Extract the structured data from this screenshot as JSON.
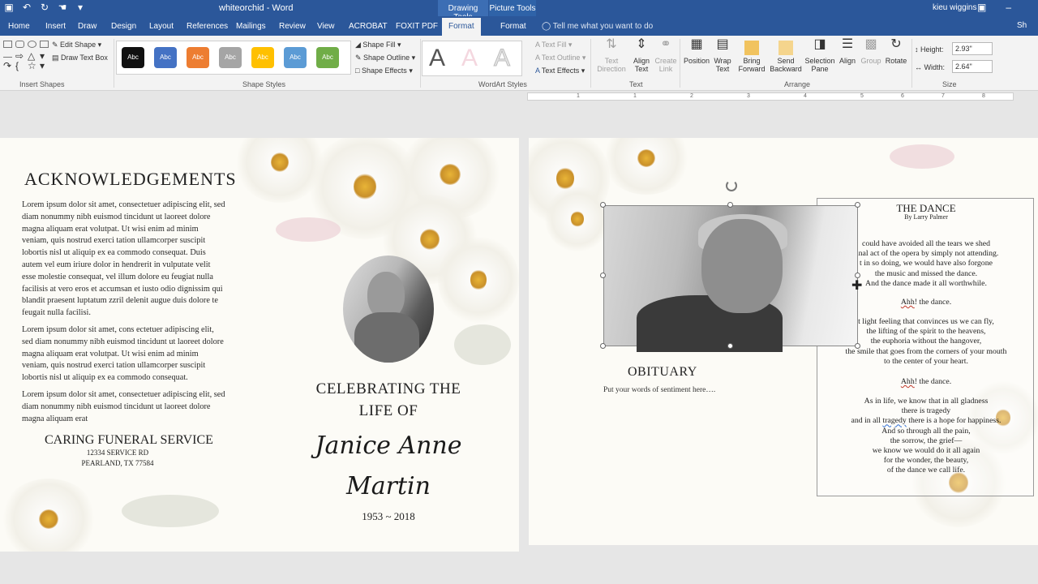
{
  "titlebar": {
    "doc_title": "whiteorchid - Word",
    "ctx_drawing": "Drawing Tools",
    "ctx_picture": "Picture Tools",
    "user": "kieu wiggins",
    "qat_icons": [
      "save-icon",
      "undo-icon",
      "redo-icon",
      "touch-icon",
      "customize-icon"
    ]
  },
  "tabs": [
    {
      "label": "Home"
    },
    {
      "label": "Insert"
    },
    {
      "label": "Draw"
    },
    {
      "label": "Design"
    },
    {
      "label": "Layout"
    },
    {
      "label": "References"
    },
    {
      "label": "Mailings"
    },
    {
      "label": "Review"
    },
    {
      "label": "View"
    },
    {
      "label": "ACROBAT"
    },
    {
      "label": "FOXIT PDF"
    },
    {
      "label": "Format"
    },
    {
      "label": "Format"
    }
  ],
  "tell_me": "Tell me what you want to do",
  "share": "Sh",
  "ribbon": {
    "insert_shapes": {
      "edit_shape": "Edit Shape",
      "draw_text_box": "Draw Text Box",
      "label": "Insert Shapes"
    },
    "shape_styles": {
      "swatches": [
        {
          "text": "Abc",
          "color": "#111111"
        },
        {
          "text": "Abc",
          "color": "#4472c4"
        },
        {
          "text": "Abc",
          "color": "#ed7d31"
        },
        {
          "text": "Abc",
          "color": "#a5a5a5"
        },
        {
          "text": "Abc",
          "color": "#ffc000"
        },
        {
          "text": "Abc",
          "color": "#5b9bd5"
        },
        {
          "text": "Abc",
          "color": "#70ad47"
        }
      ],
      "shape_fill": "Shape Fill",
      "shape_outline": "Shape Outline",
      "shape_effects": "Shape Effects",
      "label": "Shape Styles"
    },
    "wordart": {
      "letters": [
        "A",
        "A",
        "A"
      ],
      "text_fill": "Text Fill",
      "text_outline": "Text Outline",
      "text_effects": "Text Effects",
      "label": "WordArt Styles"
    },
    "text_group": {
      "text_direction": "Text Direction",
      "align_text": "Align Text",
      "create_link": "Create Link",
      "label": "Text"
    },
    "arrange": {
      "position": "Position",
      "wrap_text": "Wrap Text",
      "bring_forward": "Bring Forward",
      "send_backward": "Send Backward",
      "selection_pane": "Selection Pane",
      "align": "Align",
      "group": "Group",
      "rotate": "Rotate",
      "label": "Arrange"
    },
    "size": {
      "height_label": "Height:",
      "height_value": "2.93\"",
      "width_label": "Width:",
      "width_value": "2.64\"",
      "label": "Size"
    }
  },
  "ruler_marks": [
    "1",
    "1",
    "2",
    "3",
    "4",
    "5",
    "6",
    "7",
    "8"
  ],
  "left_page": {
    "ack_title": "ACKNOWLEDGEMENTS",
    "paragraphs": [
      "Lorem ipsum dolor sit amet, consectetuer adipiscing elit, sed diam nonummy nibh euismod tincidunt ut laoreet dolore magna aliquam erat volutpat. Ut wisi enim ad minim veniam, quis nostrud exerci tation ullamcorper suscipit lobortis nisl ut aliquip ex ea commodo consequat. Duis autem vel eum iriure dolor in hendrerit in vulputate velit esse molestie consequat, vel illum dolore eu feugiat nulla facilisis at vero eros et accumsan et iusto odio dignissim qui blandit praesent luptatum zzril delenit augue duis dolore te feugait nulla facilisi.",
      "Lorem ipsum dolor sit amet, cons ectetuer adipiscing elit, sed diam nonummy nibh euismod tincidunt ut laoreet dolore magna aliquam erat volutpat. Ut wisi enim ad minim veniam, quis nostrud exerci tation ullamcorper suscipit lobortis nisl ut aliquip ex ea commodo consequat.",
      "Lorem ipsum dolor sit amet, consectetuer adipiscing elit, sed diam nonummy nibh euismod tincidunt ut laoreet dolore magna aliquam erat"
    ],
    "funeral_name": "CARING FUNERAL SERVICE",
    "funeral_street": "12334 SERVICE RD",
    "funeral_city": "PEARLAND, TX 77584",
    "celebrate_line1": "CELEBRATING THE",
    "celebrate_line2": "LIFE OF",
    "name_line1": "Janice Anne",
    "name_line2": "Martin",
    "years": "1953 ~ 2018"
  },
  "right_page": {
    "obit_title": "OBITUARY",
    "obit_text": "Put your words of sentiment here….",
    "dance_title": "THE DANCE",
    "dance_author": "By Larry Palmer",
    "stanza1": [
      "could have avoided all the tears we shed",
      "final act of the opera by simply not attending.",
      "t in so doing, we would have also forgone",
      "the music and missed the dance.",
      "And the dance made it all worthwhile."
    ],
    "ahh1_word": "Ahh",
    "ahh1_rest": "! the dance.",
    "stanza2": [
      "t light feeling that convinces us we can fly,",
      "the lifting of the spirit to the heavens,",
      "the euphoria without the hangover,",
      "the smile that goes from the corners of your mouth",
      "to the center of your heart."
    ],
    "ahh2_word": "Ahh",
    "ahh2_rest": "! the dance.",
    "stanza3_a": [
      "As in life, we know that in all gladness",
      "there is tragedy"
    ],
    "stanza3_line_pre": "and in all ",
    "stanza3_line_word": "tragedy",
    "stanza3_line_post": " there is a hope for happiness.",
    "stanza3_b": [
      "And so through all the pain,",
      "the sorrow, the grief—",
      "we know we would do it all again",
      "for the wonder, the beauty,",
      "of the dance we call life."
    ]
  }
}
